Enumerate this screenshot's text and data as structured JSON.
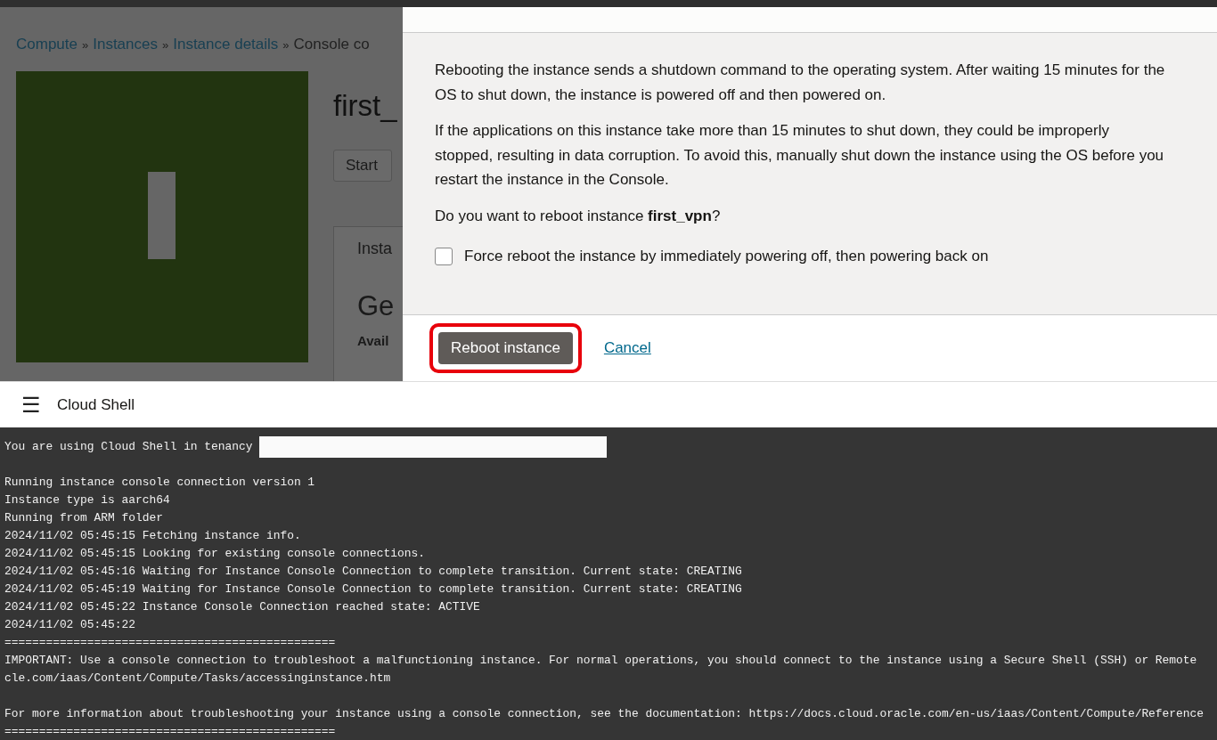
{
  "page": {
    "breadcrumb": [
      {
        "label": "Compute",
        "link": true
      },
      {
        "label": "Instances",
        "link": true
      },
      {
        "label": "Instance details",
        "link": true
      },
      {
        "label": "Console co",
        "link": false
      }
    ],
    "separator": "»",
    "title": "first_",
    "start_button": "Start",
    "panel_tab": "Insta",
    "section_heading": "Ge",
    "field_label": "Avail"
  },
  "dialog": {
    "paragraphs": [
      "Rebooting the instance sends a shutdown command to the operating system. After waiting 15 minutes for the OS to shut down, the instance is powered off and then powered on.",
      "If the applications on this instance take more than 15 minutes to shut down, they could be improperly stopped, resulting in data corruption. To avoid this, manually shut down the instance using the OS before you restart the instance in the Console.",
      "Do you want to reboot instance **first_vpn**?"
    ],
    "force_reboot": {
      "label": "Force reboot the instance by immediately powering off, then powering back on",
      "checked": false
    },
    "reboot_button": "Reboot instance",
    "highlighted": true,
    "cancel_link": "Cancel"
  },
  "cloud_shell": {
    "title": "Cloud Shell",
    "menu_icon": "☰",
    "lines": [
      {
        "kind": "redacted",
        "text": "You are using Cloud Shell in tenancy"
      },
      {
        "kind": "blank"
      },
      {
        "kind": "text",
        "text": "Running instance console connection version 1"
      },
      {
        "kind": "text",
        "text": "Instance type is aarch64"
      },
      {
        "kind": "text",
        "text": "Running from ARM folder"
      },
      {
        "kind": "text",
        "text": "2024/11/02 05:45:15 Fetching instance info."
      },
      {
        "kind": "text",
        "text": "2024/11/02 05:45:15 Looking for existing console connections."
      },
      {
        "kind": "text",
        "text": "2024/11/02 05:45:16 Waiting for Instance Console Connection to complete transition. Current state: CREATING"
      },
      {
        "kind": "text",
        "text": "2024/11/02 05:45:19 Waiting for Instance Console Connection to complete transition. Current state: CREATING"
      },
      {
        "kind": "text",
        "text": "2024/11/02 05:45:22 Instance Console Connection reached state: ACTIVE"
      },
      {
        "kind": "text",
        "text": "2024/11/02 05:45:22"
      },
      {
        "kind": "text",
        "text": "================================================"
      },
      {
        "kind": "text",
        "text": "IMPORTANT: Use a console connection to troubleshoot a malfunctioning instance. For normal operations, you should connect to the instance using a Secure Shell (SSH) or Remote"
      },
      {
        "kind": "text",
        "text": "cle.com/iaas/Content/Compute/Tasks/accessinginstance.htm"
      },
      {
        "kind": "blank"
      },
      {
        "kind": "text",
        "text": "For more information about troubleshooting your instance using a console connection, see the documentation: https://docs.cloud.oracle.com/en-us/iaas/Content/Compute/Reference"
      },
      {
        "kind": "text",
        "text": "================================================"
      }
    ]
  }
}
